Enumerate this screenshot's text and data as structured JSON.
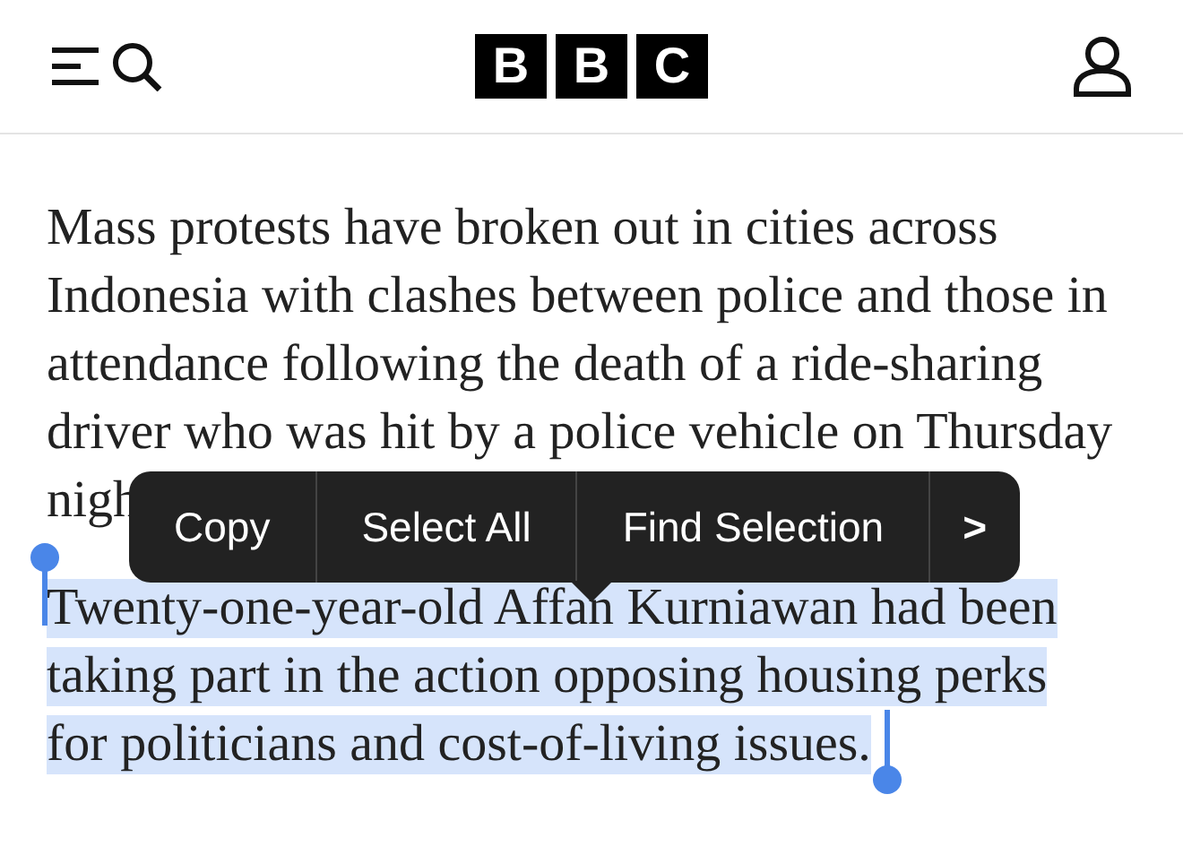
{
  "header": {
    "logo": [
      "B",
      "B",
      "C"
    ]
  },
  "article": {
    "paragraphs": [
      {
        "lines": [
          "Mass protests have broken out in cities across",
          "Indonesia with clashes between police and those in",
          "attendance following the death of a ride-sharing",
          "driver who was hit by a police vehicle on Thursday",
          "nigh"
        ],
        "selected": false
      },
      {
        "lines": [
          "Twenty-one-year-old Affan Kurniawan had been",
          "taking part in the action opposing housing perks",
          "for politicians and cost-of-living issues."
        ],
        "selected": true
      }
    ]
  },
  "context_menu": {
    "items": [
      {
        "label": "Copy"
      },
      {
        "label": "Select All"
      },
      {
        "label": "Find Selection"
      }
    ],
    "more": ">"
  }
}
